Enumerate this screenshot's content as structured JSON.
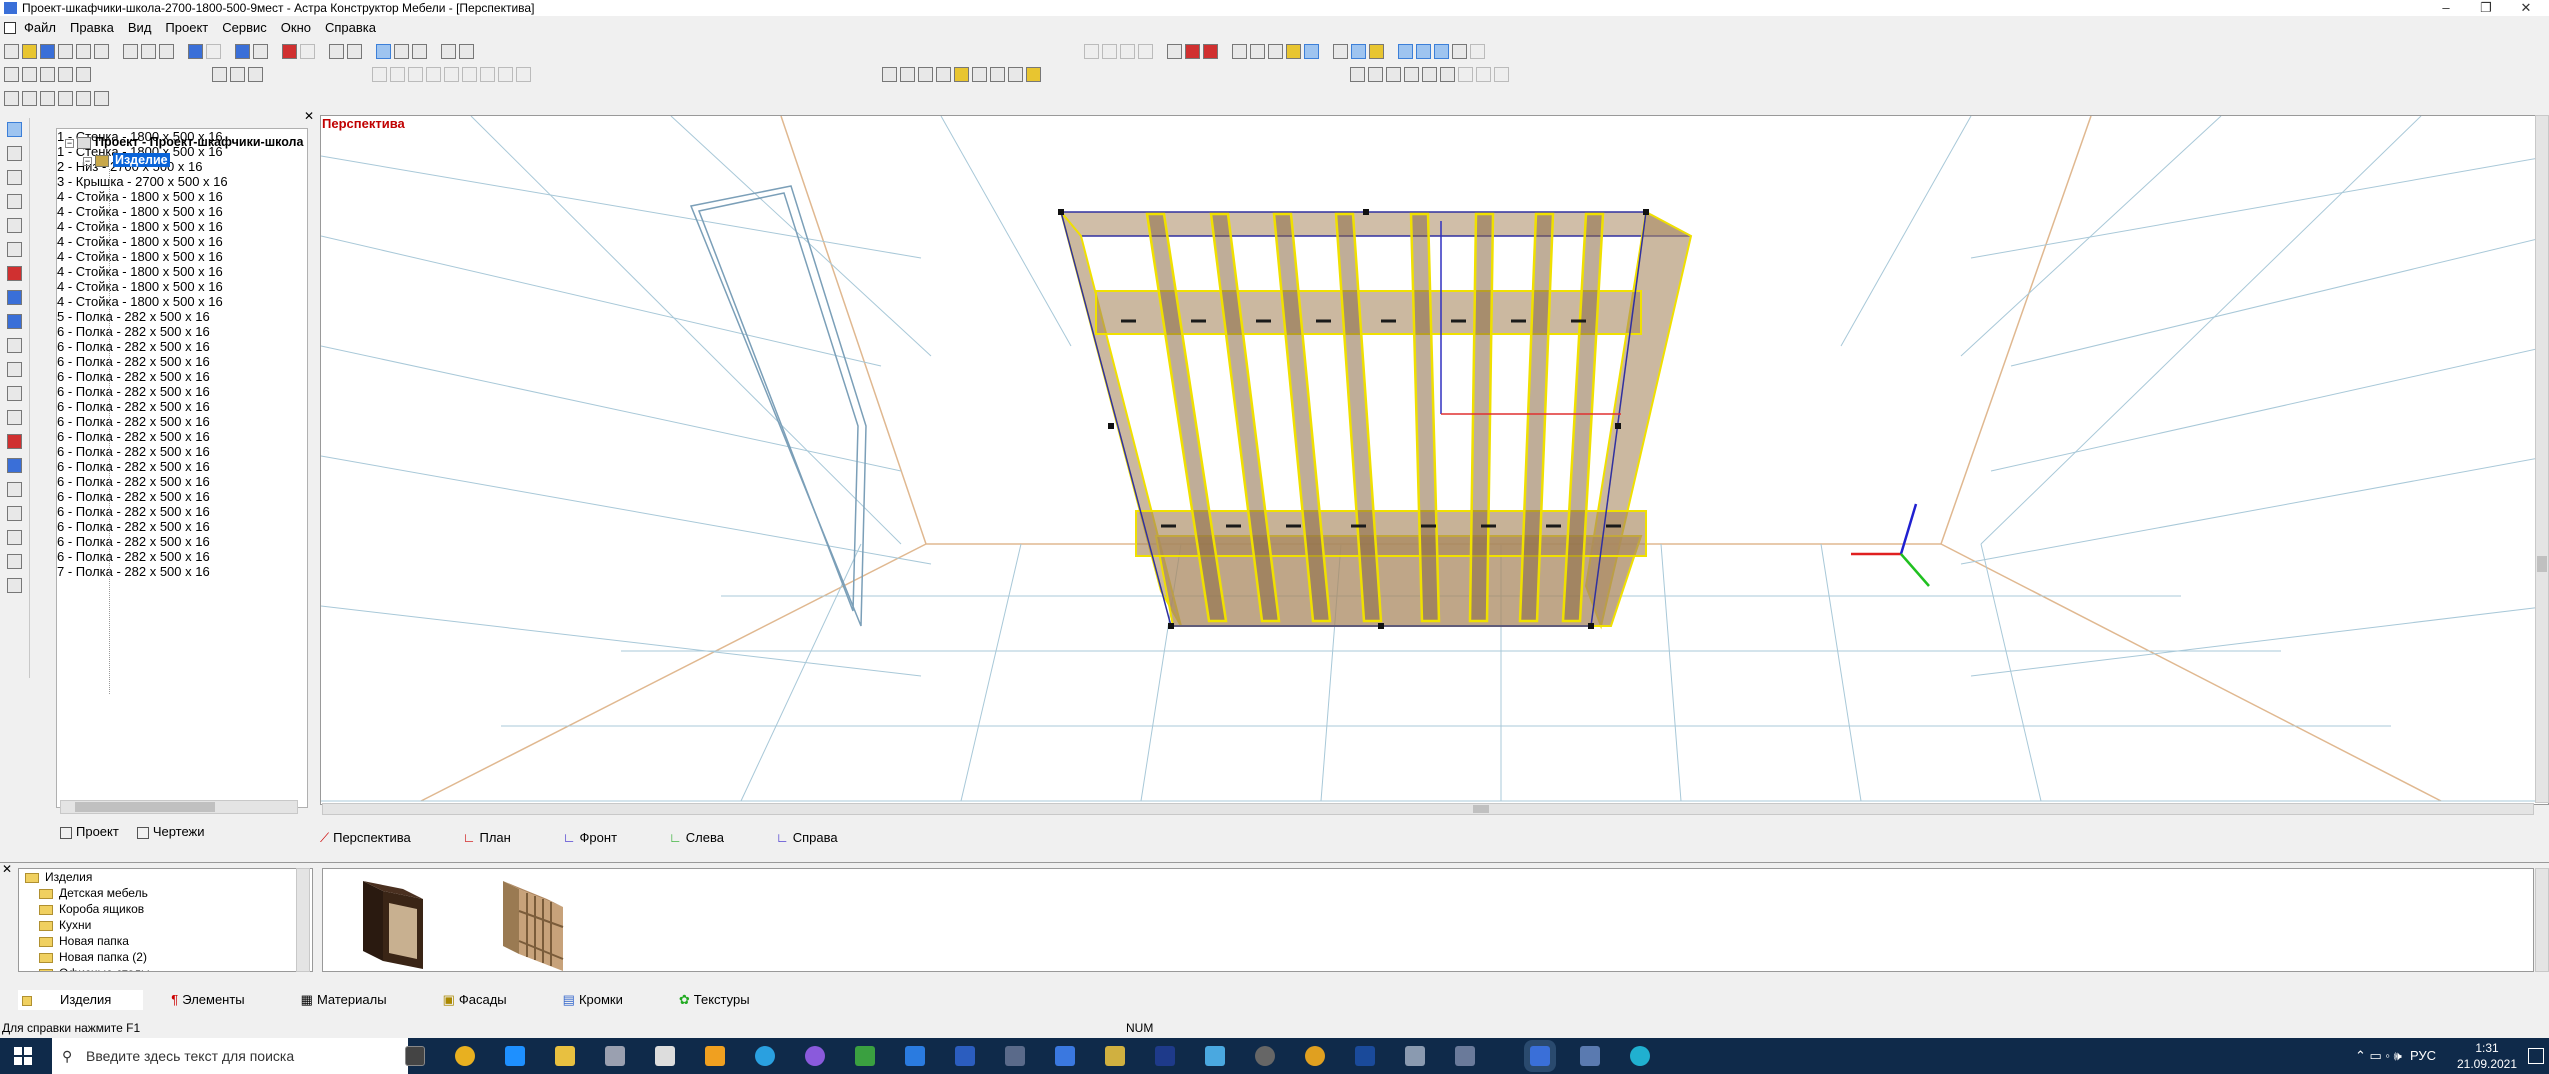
{
  "window": {
    "title": "Проект-шкафчики-школа-2700-1800-500-9мест - Астра Конструктор Мебели - [Перспектива]"
  },
  "menu": [
    "Файл",
    "Правка",
    "Вид",
    "Проект",
    "Сервис",
    "Окно",
    "Справка"
  ],
  "tree": {
    "root": "Проект - Проект-шкафчики-школа",
    "product": "Изделие",
    "items": [
      "1 - Стенка - 1800 x 500 x 16",
      "1 - Стенка - 1800 x 500 x 16",
      "2 - Низ - 2700 x 500 x 16",
      "3 - Крышка - 2700 x 500 x 16",
      "4 - Стойка - 1800 x 500 x 16",
      "4 - Стойка - 1800 x 500 x 16",
      "4 - Стойка - 1800 x 500 x 16",
      "4 - Стойка - 1800 x 500 x 16",
      "4 - Стойка - 1800 x 500 x 16",
      "4 - Стойка - 1800 x 500 x 16",
      "4 - Стойка - 1800 x 500 x 16",
      "4 - Стойка - 1800 x 500 x 16",
      "5 - Полка - 282 x 500 x 16",
      "6 - Полка - 282 x 500 x 16",
      "6 - Полка - 282 x 500 x 16",
      "6 - Полка - 282 x 500 x 16",
      "6 - Полка - 282 x 500 x 16",
      "6 - Полка - 282 x 500 x 16",
      "6 - Полка - 282 x 500 x 16",
      "6 - Полка - 282 x 500 x 16",
      "6 - Полка - 282 x 500 x 16",
      "6 - Полка - 282 x 500 x 16",
      "6 - Полка - 282 x 500 x 16",
      "6 - Полка - 282 x 500 x 16",
      "6 - Полка - 282 x 500 x 16",
      "6 - Полка - 282 x 500 x 16",
      "6 - Полка - 282 x 500 x 16",
      "6 - Полка - 282 x 500 x 16",
      "6 - Полка - 282 x 500 x 16",
      "7 - Полка - 282 x 500 x 16"
    ]
  },
  "project_tabs": [
    "Проект",
    "Чертежи"
  ],
  "viewport": {
    "label": "Перспектива"
  },
  "view_tabs": [
    "Перспектива",
    "План",
    "Фронт",
    "Слева",
    "Справа"
  ],
  "library": {
    "root": "Изделия",
    "folders": [
      "Детская мебель",
      "Короба ящиков",
      "Кухни",
      "Новая папка",
      "Новая папка (2)",
      "Офисные столы"
    ]
  },
  "library_tabs": [
    "Изделия",
    "Элементы",
    "Материалы",
    "Фасады",
    "Кромки",
    "Текстуры"
  ],
  "status": {
    "help": "Для справки нажмите F1",
    "num": "NUM"
  },
  "taskbar": {
    "search_placeholder": "Введите здесь текст для поиска",
    "lang": "РУС",
    "time": "1:31",
    "date": "21.09.2021"
  },
  "colors": {
    "accent": "#0a64d8",
    "panel": "#a98860",
    "edge": "#f0e000",
    "label": "#c00000"
  }
}
